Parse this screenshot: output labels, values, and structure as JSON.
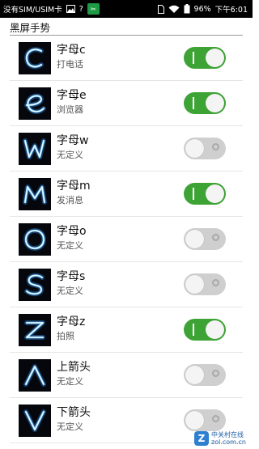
{
  "status": {
    "carrier": "没有SIM/USIM卡",
    "battery": "96%",
    "time": "下午6:01"
  },
  "section": {
    "title": "黑屏手势"
  },
  "gestures": [
    {
      "title": "字母c",
      "subtitle": "打电话",
      "enabled": true,
      "glyph": "c"
    },
    {
      "title": "字母e",
      "subtitle": "浏览器",
      "enabled": true,
      "glyph": "e"
    },
    {
      "title": "字母w",
      "subtitle": "无定义",
      "enabled": false,
      "glyph": "w"
    },
    {
      "title": "字母m",
      "subtitle": "发消息",
      "enabled": true,
      "glyph": "m"
    },
    {
      "title": "字母o",
      "subtitle": "无定义",
      "enabled": false,
      "glyph": "o"
    },
    {
      "title": "字母s",
      "subtitle": "无定义",
      "enabled": false,
      "glyph": "s"
    },
    {
      "title": "字母z",
      "subtitle": "拍照",
      "enabled": true,
      "glyph": "z"
    },
    {
      "title": "上箭头",
      "subtitle": "无定义",
      "enabled": false,
      "glyph": "up"
    },
    {
      "title": "下箭头",
      "subtitle": "无定义",
      "enabled": false,
      "glyph": "down"
    }
  ],
  "watermark": {
    "brand": "中关村在线",
    "site": "zol.com.cn"
  },
  "colors": {
    "toggle_on": "#3ea335",
    "toggle_off": "#cfcfcf",
    "glow": "#7fd0ff"
  }
}
